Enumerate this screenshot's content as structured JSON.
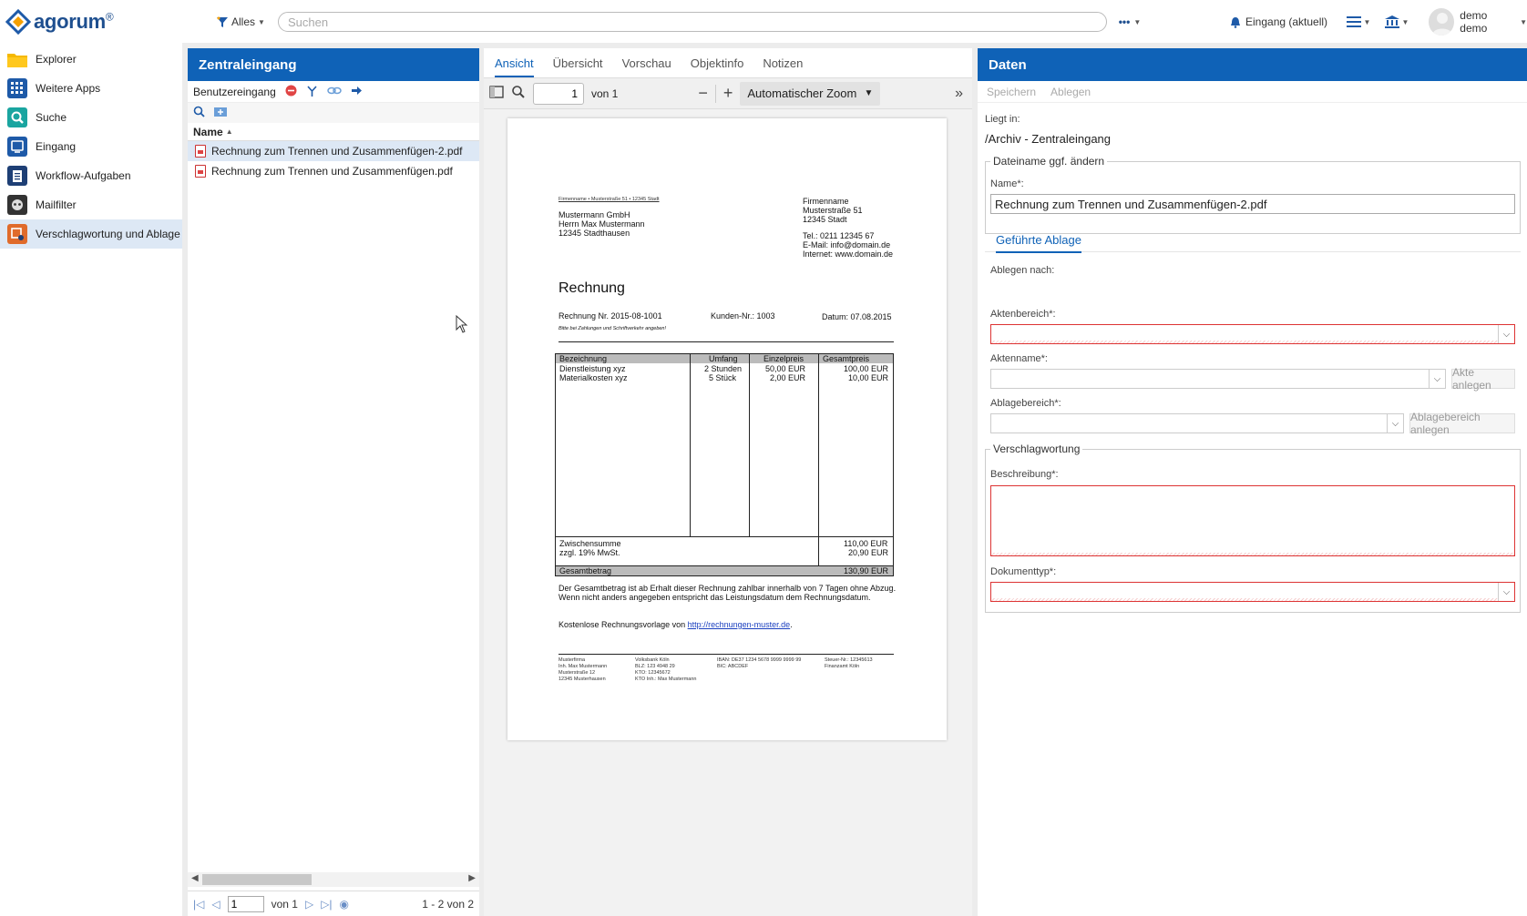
{
  "app": {
    "logo_text": "agorum",
    "logo_reg": "®"
  },
  "topbar": {
    "scope_label": "Alles",
    "search_placeholder": "Suchen",
    "inbox_label": "Eingang (aktuell)",
    "user_label": "demo demo"
  },
  "sidebar": {
    "items": [
      {
        "label": "Explorer",
        "icon": "folder-icon",
        "color": "#f5b800"
      },
      {
        "label": "Weitere Apps",
        "icon": "grid-icon",
        "color": "#1e5aa8"
      },
      {
        "label": "Suche",
        "icon": "search-icon",
        "color": "#1aa5a0"
      },
      {
        "label": "Eingang",
        "icon": "inbox-icon",
        "color": "#1e5aa8"
      },
      {
        "label": "Workflow-Aufgaben",
        "icon": "clipboard-icon",
        "color": "#1e3f75"
      },
      {
        "label": "Mailfilter",
        "icon": "robot-icon",
        "color": "#333333"
      },
      {
        "label": "Verschlagwortung und Ablage",
        "icon": "tagging-icon",
        "color": "#e06b2b"
      }
    ]
  },
  "list_panel": {
    "title": "Zentraleingang",
    "subtitle": "Benutzereingang",
    "column_name": "Name",
    "files": [
      "Rechnung zum Trennen und Zusammenfügen-2.pdf",
      "Rechnung zum Trennen und Zusammenfügen.pdf"
    ],
    "pager": {
      "page": "1",
      "of": "von 1",
      "range": "1 - 2 von 2"
    }
  },
  "viewer": {
    "tabs": [
      "Ansicht",
      "Übersicht",
      "Vorschau",
      "Objektinfo",
      "Notizen"
    ],
    "page_input": "1",
    "page_of": "von 1",
    "zoom": "Automatischer Zoom",
    "doc": {
      "sender_line": "Firmenname • Musterstraße 51 • 12345 Stadt",
      "recipient": [
        "Mustermann GmbH",
        "Herrn Max Mustermann",
        "12345 Stadthausen"
      ],
      "company": [
        "Firmenname",
        "Musterstraße 51",
        "12345 Stadt"
      ],
      "contact": [
        "Tel.: 0211 12345 67",
        "E-Mail: info@domain.de",
        "Internet: www.domain.de"
      ],
      "heading": "Rechnung",
      "invoice_no": "Rechnung Nr. 2015-08-1001",
      "customer_no": "Kunden-Nr.: 1003",
      "date": "Datum: 07.08.2015",
      "note": "Bitte bei Zahlungen und Schriftverkehr angeben!",
      "table_head": [
        "Bezeichnung",
        "Umfang",
        "Einzelpreis",
        "Gesamtpreis"
      ],
      "rows": [
        [
          "Dienstleistung xyz",
          "2 Stunden",
          "50,00 EUR",
          "100,00 EUR"
        ],
        [
          "Materialkosten xyz",
          "5 Stück",
          "2,00 EUR",
          "10,00 EUR"
        ]
      ],
      "subtotal_label": "Zwischensumme",
      "subtotal": "110,00 EUR",
      "vat_label": "zzgl. 19% MwSt.",
      "vat": "20,90 EUR",
      "total_label": "Gesamtbetrag",
      "total": "130,90 EUR",
      "terms1": "Der Gesamtbetrag ist ab Erhalt dieser Rechnung zahlbar innerhalb von 7 Tagen ohne Abzug.",
      "terms2": "Wenn nicht anders angegeben entspricht das Leistungsdatum dem Rechnungsdatum.",
      "template_prefix": "Kostenlose Rechnungsvorlage von",
      "template_link": "http://rechnungen-muster.de",
      "template_suffix": ".",
      "footer_col1": [
        "Musterfirma",
        "Inh. Max Mustermann",
        "Musterstraße 12",
        "12345 Musterhausen"
      ],
      "footer_col2": [
        "Volksbank Köln",
        "BLZ: 123 4948 29",
        "KTO: 12345672",
        "KTO Inh.: Max Mustermann"
      ],
      "footer_col3": [
        "IBAN: DE37 1234 5678 9999 9999 99",
        "BIC: ABCDEF"
      ],
      "footer_col4": [
        "Steuer-Nr.: 12345613",
        "Finanzamt Köln"
      ]
    }
  },
  "data_panel": {
    "title": "Daten",
    "save_label": "Speichern",
    "file_label": "Ablegen",
    "located_label": "Liegt in:",
    "located_value": "/Archiv - Zentraleingang",
    "rename_legend": "Dateiname ggf. ändern",
    "name_label": "Name*:",
    "name_value": "Rechnung zum Trennen und Zusammenfügen-2.pdf",
    "guided_tab": "Geführte Ablage",
    "file_to_label": "Ablegen nach:",
    "aktenbereich_label": "Aktenbereich*:",
    "aktenname_label": "Aktenname*:",
    "create_file_btn": "Akte anlegen",
    "ablagebereich_label": "Ablagebereich*:",
    "create_area_btn": "Ablagebereich anlegen",
    "tagging_legend": "Verschlagwortung",
    "description_label": "Beschreibung*:",
    "doctype_label": "Dokumenttyp*:"
  }
}
